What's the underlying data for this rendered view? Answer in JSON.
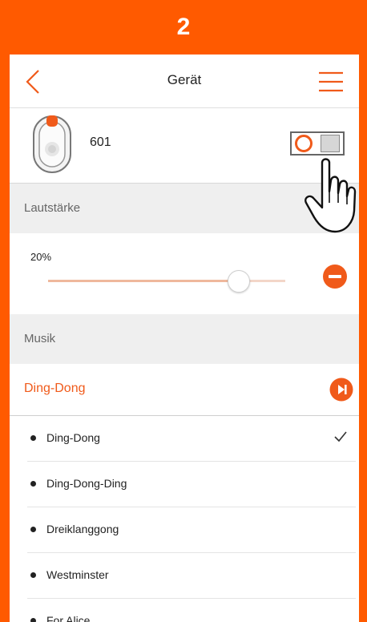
{
  "step_banner": {
    "number": "2"
  },
  "header": {
    "title": "Gerät"
  },
  "device": {
    "name": "601"
  },
  "volume": {
    "section_label": "Lautstärke",
    "value_text": "20%",
    "level_fraction": 0.8
  },
  "music": {
    "section_label": "Musik",
    "selected": "Ding-Dong",
    "songs": [
      {
        "label": "Ding-Dong",
        "checked": true
      },
      {
        "label": "Ding-Dong-Ding",
        "checked": false
      },
      {
        "label": "Dreiklanggong",
        "checked": false
      },
      {
        "label": "Westminster",
        "checked": false
      },
      {
        "label": "For Alice",
        "checked": false
      }
    ]
  },
  "colors": {
    "accent": "#ff5a00",
    "accent_soft": "#f05a1a",
    "section_bg": "#efefef"
  },
  "icons": {
    "back": "chevron-left-icon",
    "menu": "hamburger-menu-icon",
    "device": "doorbell-device-icon",
    "minus": "minus-circle-icon",
    "play": "play-next-icon",
    "check": "checkmark-icon",
    "hand": "pointing-hand-icon"
  }
}
